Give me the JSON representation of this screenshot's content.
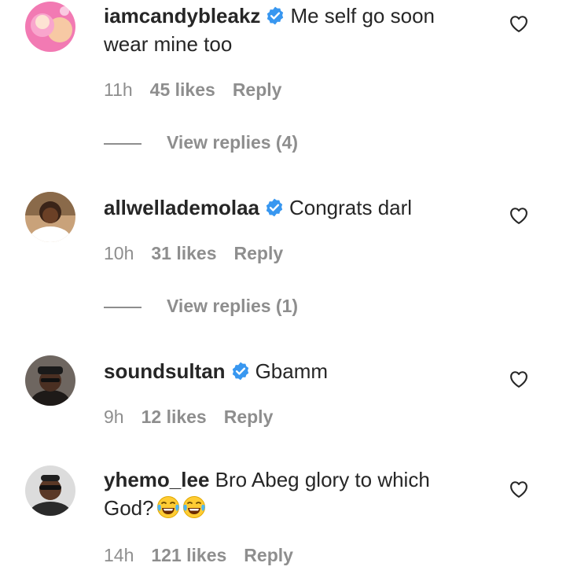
{
  "comments": [
    {
      "username": "iamcandybleakz",
      "verified": true,
      "text": "Me self go soon wear mine too",
      "time": "11h",
      "likes": "45 likes",
      "reply": "Reply",
      "view_replies": "View replies (4)"
    },
    {
      "username": "allwellademolaa",
      "verified": true,
      "text": "Congrats darl",
      "time": "10h",
      "likes": "31 likes",
      "reply": "Reply",
      "view_replies": "View replies (1)"
    },
    {
      "username": "soundsultan",
      "verified": true,
      "text": "Gbamm",
      "time": "9h",
      "likes": "12 likes",
      "reply": "Reply"
    },
    {
      "username": "yhemo_lee",
      "verified": false,
      "text": "Bro Abeg glory to which God?",
      "emojis": [
        "tears-of-joy",
        "tears-of-joy"
      ],
      "time": "14h",
      "likes": "121 likes",
      "reply": "Reply"
    }
  ],
  "colors": {
    "text": "#262626",
    "secondary": "#8e8e8e",
    "verified_blue": "#3897f0"
  },
  "icons": {
    "like": "heart-outline-icon",
    "verified": "verified-badge-icon",
    "emoji": "face-with-tears-of-joy-icon"
  }
}
